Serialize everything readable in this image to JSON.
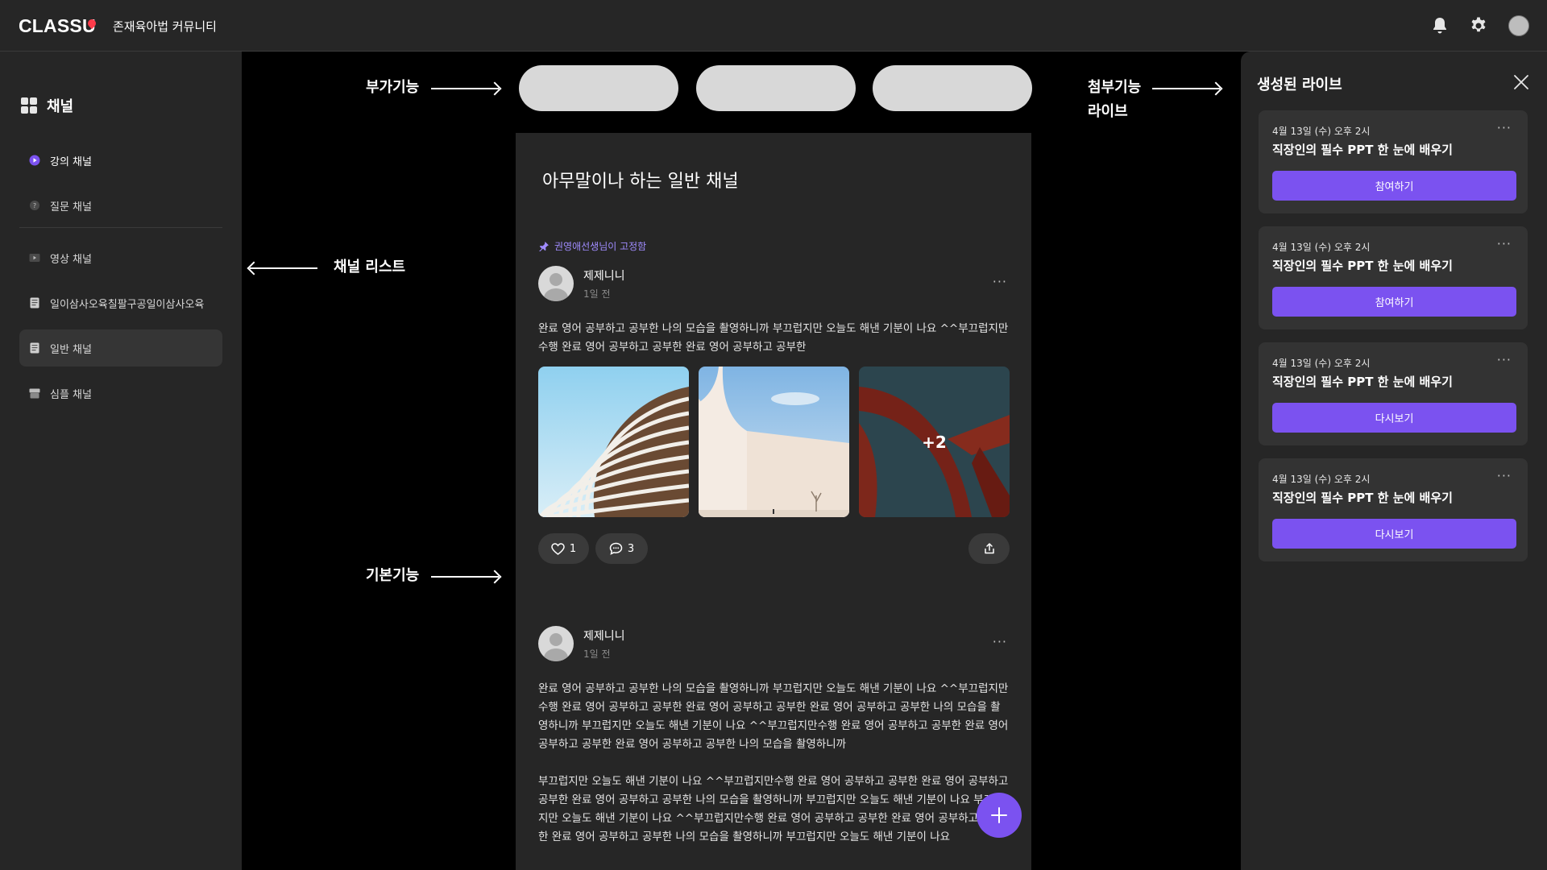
{
  "topbar": {
    "logo": "CLASSU",
    "community_name": "존재육아법 커뮤니티",
    "icons": [
      "bell-icon",
      "gear-icon",
      "avatar"
    ]
  },
  "sidebar": {
    "heading": "채널",
    "items": [
      {
        "label": "강의 채널",
        "icon": "play-circle-icon",
        "active": false
      },
      {
        "label": "질문 채널",
        "icon": "question-icon",
        "active": false
      },
      {
        "label": "영상 채널",
        "icon": "video-icon",
        "active": false
      },
      {
        "label": "일이삼사오육칠팔구공일이삼사오육",
        "icon": "document-icon",
        "active": false
      },
      {
        "label": "일반 채널",
        "icon": "document-icon",
        "active": true
      },
      {
        "label": "심플 채널",
        "icon": "box-icon",
        "active": false
      }
    ]
  },
  "annotations": {
    "extra": "부가기능",
    "channel_list": "채널 리스트",
    "basic": "기본기능",
    "attach_line1": "첨부기능",
    "attach_line2": "라이브"
  },
  "feed": {
    "title": "아무말이나 하는 일반 채널",
    "pinned_text": "권영애선생님이 고정함",
    "posts": [
      {
        "author": "제제니니",
        "time": "1일 전",
        "body": [
          "완료 영어 공부하고 공부한 나의 모습을 촬영하니까 부끄럽지만 오늘도 해낸 기분이 나요 ^^부끄럽지만수행 완료 영어 공부하고 공부한 완료 영어 공부하고 공부한"
        ],
        "extra_images": "+2",
        "likes": "1",
        "comments": "3"
      },
      {
        "author": "제제니니",
        "time": "1일 전",
        "body": [
          "완료 영어 공부하고 공부한 나의 모습을 촬영하니까 부끄럽지만 오늘도 해낸 기분이 나요 ^^부끄럽지만수행 완료 영어 공부하고 공부한 완료 영어 공부하고 공부한 완료 영어 공부하고 공부한 나의 모습을 촬영하니까 부끄럽지만 오늘도 해낸 기분이 나요 ^^부끄럽지만수행 완료 영어 공부하고 공부한 완료 영어 공부하고 공부한 완료 영어 공부하고 공부한 나의 모습을 촬영하니까",
          "부끄럽지만 오늘도 해낸 기분이 나요 ^^부끄럽지만수행 완료 영어 공부하고 공부한 완료 영어 공부하고 공부한 완료 영어 공부하고 공부한 나의 모습을 촬영하니까 부끄럽지만 오늘도 해낸 기분이 나요 부끄럽지만 오늘도 해낸 기분이 나요 ^^부끄럽지만수행 완료 영어 공부하고 공부한 완료 영어 공부하고 공부한 완료 영어 공부하고 공부한 나의 모습을 촬영하니까 부끄럽지만 오늘도 해낸 기분이 나요"
        ]
      }
    ]
  },
  "live": {
    "title": "생성된 라이브",
    "cards": [
      {
        "date": "4월 13일 (수) 오후 2시",
        "title": "직장인의 필수 PPT 한 눈에 배우기",
        "button": "참여하기"
      },
      {
        "date": "4월 13일 (수) 오후 2시",
        "title": "직장인의 필수 PPT 한 눈에 배우기",
        "button": "참여하기"
      },
      {
        "date": "4월 13일 (수) 오후 2시",
        "title": "직장인의 필수 PPT 한 눈에 배우기",
        "button": "다시보기"
      },
      {
        "date": "4월 13일 (수) 오후 2시",
        "title": "직장인의 필수 PPT 한 눈에 배우기",
        "button": "다시보기"
      }
    ]
  },
  "colors": {
    "accent": "#7b52f0",
    "background": "#000000",
    "panel": "#262626",
    "pin": "#a08cff"
  }
}
